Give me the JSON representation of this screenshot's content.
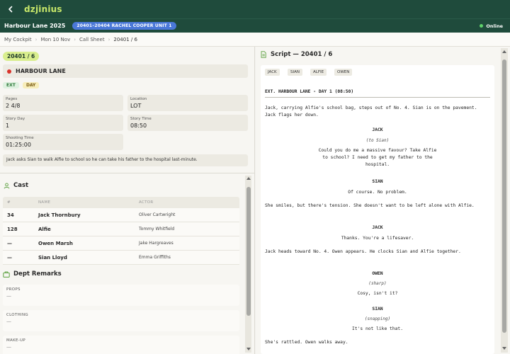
{
  "app": {
    "brand": "dzjinius",
    "project": "Harbour Lane 2025",
    "unit_badge": "20401–20404 RACHEL COOPER UNIT 1",
    "status": "Online"
  },
  "breadcrumb": [
    "My Cockpit",
    "Mon 10 Nov",
    "Call Sheet",
    "20401 / 6"
  ],
  "scene": {
    "number": "20401 / 6",
    "title": "HARBOUR LANE",
    "tags": [
      "EXT",
      "DAY"
    ],
    "fields": [
      {
        "label": "Pages",
        "value": "2 4/8"
      },
      {
        "label": "Location",
        "value": "LOT"
      },
      {
        "label": "Story Day",
        "value": "1"
      },
      {
        "label": "Story Time",
        "value": "08:50"
      },
      {
        "label": "Shooting Time",
        "value": "01:25:00"
      }
    ],
    "synopsis": "Jack asks Sian to walk Alfie to school so he can take his father to the hospital last-minute."
  },
  "cast": {
    "title": "Cast",
    "columns": [
      "#",
      "NAME",
      "ACTOR"
    ],
    "rows": [
      {
        "num": "34",
        "name": "Jack Thornbury",
        "actor": "Oliver Cartwright"
      },
      {
        "num": "128",
        "name": "Alfie",
        "actor": "Tommy Whitfield"
      },
      {
        "num": "—",
        "name": "Owen Marsh",
        "actor": "Jake Hargreaves"
      },
      {
        "num": "—",
        "name": "Sian Lloyd",
        "actor": "Emma Griffiths"
      }
    ]
  },
  "remarks": {
    "title": "Dept Remarks",
    "items": [
      {
        "label": "PROPS",
        "value": "—"
      },
      {
        "label": "CLOTHING",
        "value": "—"
      },
      {
        "label": "MAKE-UP",
        "value": "—"
      }
    ]
  },
  "script": {
    "title": "Script — 20401 / 6",
    "characters": [
      "JACK",
      "SIAN",
      "ALFIE",
      "OWEN"
    ],
    "heading": "EXT. HARBOUR LANE - DAY 1 (08:50)",
    "action1": "Jack, carrying Alfie's school bag, steps out of No. 4. Sian is on the pavement. Jack flags her down.",
    "char1": "JACK",
    "paren1": "(to Sian)",
    "dialogue1": "Could you do me a massive favour? Take Alfie to school? I need to get my father to the hospital.",
    "char2": "SIAN",
    "dialogue2": "Of course. No problem.",
    "action2": "She smiles, but there's tension. She doesn't want to be left alone with Alfie.",
    "char3": "JACK",
    "dialogue3": "Thanks. You're a lifesaver.",
    "action3": "Jack heads toward No. 4. Owen appears. He clocks Sian and Alfie together.",
    "char4": "OWEN",
    "paren4": "(sharp)",
    "dialogue4": "Cosy, isn't it?",
    "char5": "SIAN",
    "paren5": "(snapping)",
    "dialogue5": "It's not like that.",
    "action4": "She's rattled. Owen walks away."
  },
  "colors": {
    "header_bg": "#1f4b3c",
    "brand": "#c8e86a",
    "badge": "#4a78d8",
    "online": "#5fd26b",
    "scene_chip": "#d9ee8e",
    "interior_dot": "#d9342b"
  }
}
